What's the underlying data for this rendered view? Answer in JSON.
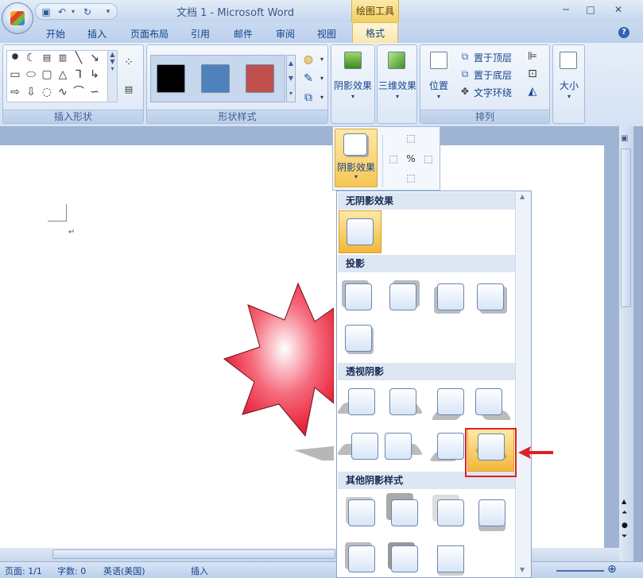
{
  "window": {
    "title": "文档 1 - Microsoft Word",
    "context_tools": "绘图工具",
    "controls": {
      "min": "─",
      "max": "□",
      "close": "✕"
    }
  },
  "tabs": [
    {
      "label": "开始"
    },
    {
      "label": "插入"
    },
    {
      "label": "页面布局"
    },
    {
      "label": "引用"
    },
    {
      "label": "邮件"
    },
    {
      "label": "审阅"
    },
    {
      "label": "视图"
    }
  ],
  "active_tab": "格式",
  "ribbon": {
    "insert_shapes": {
      "label": "插入形状"
    },
    "shape_styles": {
      "label": "形状样式",
      "swatches": [
        "#000000",
        "#4f81bd",
        "#c0504d"
      ]
    },
    "shadow": {
      "label": "阴影效果"
    },
    "three_d": {
      "label": "三维效果"
    },
    "arrange": {
      "label": "排列",
      "position": "位置",
      "bring_front": "置于顶层",
      "send_back": "置于底层",
      "text_wrap": "文字环绕"
    },
    "size": {
      "label": "大小"
    }
  },
  "popup": {
    "shadow_button": "阴影效果"
  },
  "gallery": {
    "sections": [
      {
        "title": "无阴影效果"
      },
      {
        "title": "投影"
      },
      {
        "title": "透视阴影"
      },
      {
        "title": "其他阴影样式"
      }
    ]
  },
  "status": {
    "page": "页面: 1/1",
    "words": "字数: 0",
    "language": "英语(美国)",
    "mode": "插入"
  },
  "colors": {
    "accent_highlight": "#f6c655",
    "selection_outline": "#e02020",
    "star_fill": "#e8223a"
  }
}
